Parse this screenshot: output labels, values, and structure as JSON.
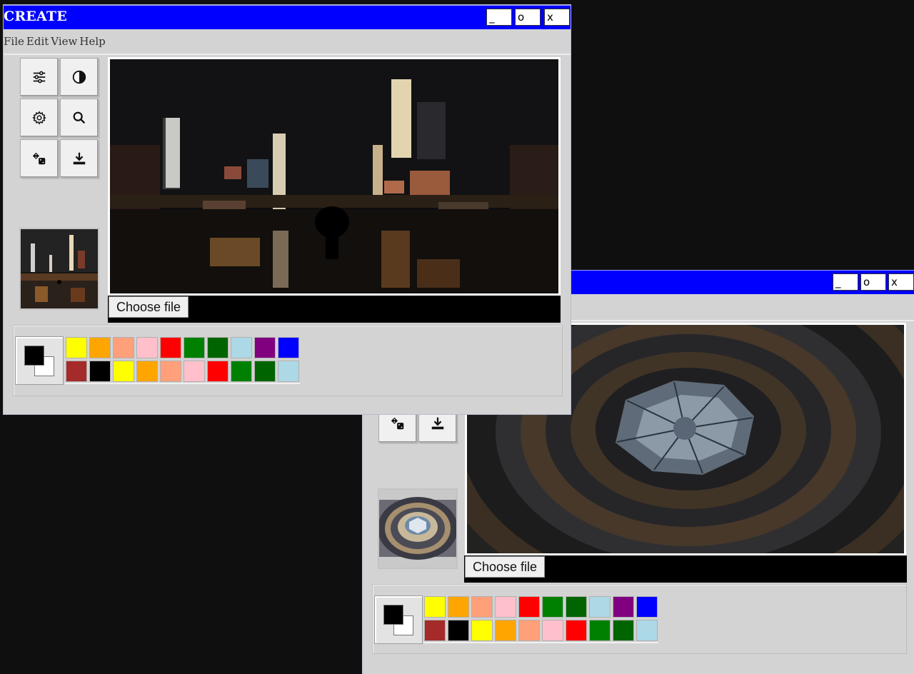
{
  "back_window": {
    "buttons": {
      "minimize": "_",
      "maximize": "o",
      "close": "x"
    },
    "choose_file": "Choose file",
    "tools": [
      {
        "name": "dice",
        "icon": "dice-icon"
      },
      {
        "name": "download",
        "icon": "download-icon"
      }
    ],
    "swatches_row1": [
      "#ffff00",
      "#ffa500",
      "#ffa07a",
      "#ffc0cb",
      "#ff0000",
      "#008000",
      "#006400",
      "#add8e6",
      "#800080",
      "#0000ff"
    ],
    "swatches_row2": [
      "#a52a2a",
      "#000000",
      "#ffff00",
      "#ffa500",
      "#ffa07a",
      "#ffc0cb",
      "#ff0000",
      "#008000",
      "#006400",
      "#add8e6"
    ],
    "foreground_color": "#000000",
    "background_color": "#ffffff"
  },
  "front_window": {
    "title": "CREATE",
    "buttons": {
      "minimize": "_",
      "maximize": "o",
      "close": "x"
    },
    "menu": [
      "File",
      "Edit",
      "View",
      "Help"
    ],
    "tools": [
      {
        "name": "adjust",
        "icon": "sliders-icon"
      },
      {
        "name": "contrast",
        "icon": "contrast-icon"
      },
      {
        "name": "settings",
        "icon": "gear-icon"
      },
      {
        "name": "search",
        "icon": "search-icon"
      },
      {
        "name": "dice",
        "icon": "dice-icon"
      },
      {
        "name": "download",
        "icon": "download-icon"
      }
    ],
    "choose_file": "Choose file",
    "swatches_row1": [
      "#ffff00",
      "#ffa500",
      "#ffa07a",
      "#ffc0cb",
      "#ff0000",
      "#008000",
      "#006400",
      "#add8e6",
      "#800080",
      "#0000ff"
    ],
    "swatches_row2": [
      "#a52a2a",
      "#000000",
      "#ffff00",
      "#ffa500",
      "#ffa07a",
      "#ffc0cb",
      "#ff0000",
      "#008000",
      "#006400",
      "#add8e6"
    ],
    "foreground_color": "#000000",
    "background_color": "#ffffff"
  },
  "colors": {
    "titlebar": "#0000ff",
    "window_bg": "#d3d3d3",
    "desktop": "#0f0f0f"
  }
}
